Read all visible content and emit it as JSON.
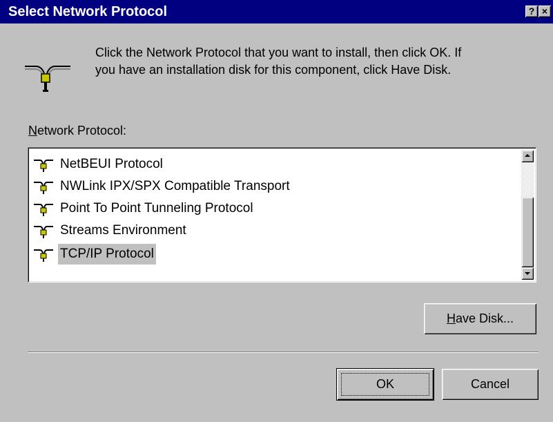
{
  "window": {
    "title": "Select Network Protocol",
    "help_label": "?",
    "close_label": "×"
  },
  "instruction": {
    "line1": "Click the Network Protocol that you want to install, then click OK.  If",
    "line2": "you have an installation disk for this component, click Have Disk."
  },
  "list": {
    "label_mnemonic": "N",
    "label_rest": "etwork Protocol:",
    "items": [
      {
        "label": "NetBEUI Protocol",
        "icon": "network-protocol-icon",
        "selected": false
      },
      {
        "label": "NWLink IPX/SPX Compatible Transport",
        "icon": "network-protocol-icon",
        "selected": false
      },
      {
        "label": "Point To Point Tunneling Protocol",
        "icon": "network-protocol-icon",
        "selected": false
      },
      {
        "label": "Streams Environment",
        "icon": "network-protocol-icon",
        "selected": false
      },
      {
        "label": "TCP/IP Protocol",
        "icon": "network-protocol-icon",
        "selected": true
      }
    ]
  },
  "buttons": {
    "have_disk_mnemonic": "H",
    "have_disk_rest": "ave Disk...",
    "ok": "OK",
    "cancel": "Cancel"
  },
  "colors": {
    "titlebar": "#000080",
    "face": "#c0c0c0",
    "selection": "#c0c0c0",
    "icon_yellow": "#c8c800"
  }
}
